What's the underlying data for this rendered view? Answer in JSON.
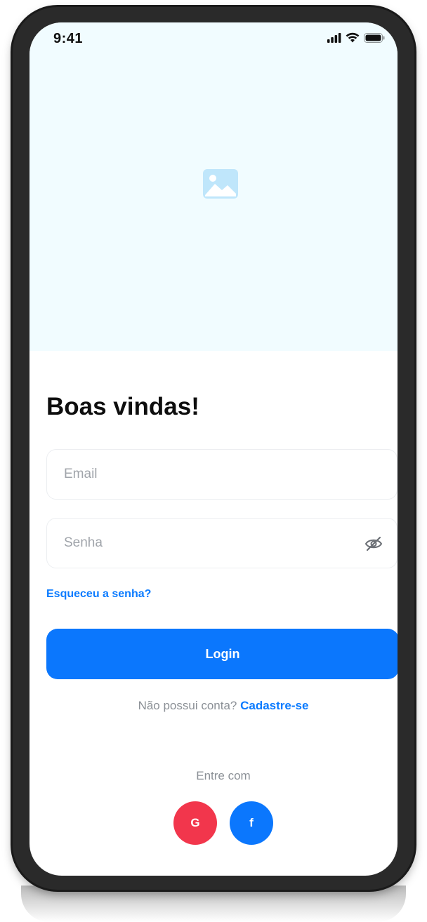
{
  "status_bar": {
    "time": "9:41",
    "icons": [
      "signal-icon",
      "wifi-icon",
      "battery-icon"
    ]
  },
  "hero": {
    "icon": "image-placeholder-icon"
  },
  "login": {
    "title": "Boas vindas!",
    "email_placeholder": "Email",
    "password_placeholder": "Senha",
    "password_toggle_icon": "eye-off-icon",
    "forgot_password": "Esqueceu a senha?",
    "login_button": "Login",
    "signup_prompt": "Não possui conta?",
    "signup_link": "Cadastre-se"
  },
  "social": {
    "label": "Entre com",
    "google_label": "G",
    "facebook_label": "f"
  },
  "colors": {
    "accent": "#0b77fd",
    "google": "#f2364c",
    "hero_background": "#f1fcff"
  }
}
